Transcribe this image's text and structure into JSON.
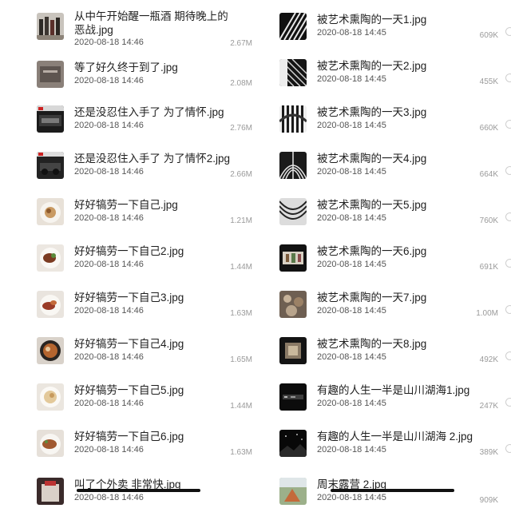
{
  "left_files": [
    {
      "name": "从中午开始醒一瓶酒 期待晚上的恶战.jpg",
      "date": "2020-08-18 14:46",
      "size": "2.67M",
      "thumbnail": "wine-bottles"
    },
    {
      "name": "等了好久终于到了.jpg",
      "date": "2020-08-18 14:46",
      "size": "2.08M",
      "thumbnail": "package-box"
    },
    {
      "name": "还是没忍住入手了 为了情怀.jpg",
      "date": "2020-08-18 14:46",
      "size": "2.76M",
      "thumbnail": "lego-box"
    },
    {
      "name": "还是没忍住入手了 为了情怀2.jpg",
      "date": "2020-08-18 14:46",
      "size": "2.66M",
      "thumbnail": "lego-car"
    },
    {
      "name": "好好犒劳一下自己.jpg",
      "date": "2020-08-18 14:46",
      "size": "1.21M",
      "thumbnail": "food-plate"
    },
    {
      "name": "好好犒劳一下自己2.jpg",
      "date": "2020-08-18 14:46",
      "size": "1.44M",
      "thumbnail": "food-plate"
    },
    {
      "name": "好好犒劳一下自己3.jpg",
      "date": "2020-08-18 14:46",
      "size": "1.63M",
      "thumbnail": "food-plate"
    },
    {
      "name": "好好犒劳一下自己4.jpg",
      "date": "2020-08-18 14:46",
      "size": "1.65M",
      "thumbnail": "food-bowl"
    },
    {
      "name": "好好犒劳一下自己5.jpg",
      "date": "2020-08-18 14:46",
      "size": "1.44M",
      "thumbnail": "food-plate"
    },
    {
      "name": "好好犒劳一下自己6.jpg",
      "date": "2020-08-18 14:46",
      "size": "1.63M",
      "thumbnail": "food-plate"
    },
    {
      "name": "叫了个外卖 非常快.jpg",
      "date": "2020-08-18 14:46",
      "size": "",
      "thumbnail": "takeout"
    }
  ],
  "right_files": [
    {
      "name": "被艺术熏陶的一天1.jpg",
      "date": "2020-08-18 14:45",
      "size": "609K",
      "thumbnail": "architecture"
    },
    {
      "name": "被艺术熏陶的一天2.jpg",
      "date": "2020-08-18 14:45",
      "size": "455K",
      "thumbnail": "architecture"
    },
    {
      "name": "被艺术熏陶的一天3.jpg",
      "date": "2020-08-18 14:45",
      "size": "660K",
      "thumbnail": "architecture"
    },
    {
      "name": "被艺术熏陶的一天4.jpg",
      "date": "2020-08-18 14:45",
      "size": "664K",
      "thumbnail": "architecture"
    },
    {
      "name": "被艺术熏陶的一天5.jpg",
      "date": "2020-08-18 14:45",
      "size": "760K",
      "thumbnail": "architecture"
    },
    {
      "name": "被艺术熏陶的一天6.jpg",
      "date": "2020-08-18 14:45",
      "size": "691K",
      "thumbnail": "gallery"
    },
    {
      "name": "被艺术熏陶的一天7.jpg",
      "date": "2020-08-18 14:45",
      "size": "1.00M",
      "thumbnail": "gallery"
    },
    {
      "name": "被艺术熏陶的一天8.jpg",
      "date": "2020-08-18 14:45",
      "size": "492K",
      "thumbnail": "gallery"
    },
    {
      "name": "有趣的人生一半是山川湖海1.jpg",
      "date": "2020-08-18 14:45",
      "size": "247K",
      "thumbnail": "night-scene"
    },
    {
      "name": "有趣的人生一半是山川湖海 2.jpg",
      "date": "2020-08-18 14:45",
      "size": "389K",
      "thumbnail": "night-scene"
    },
    {
      "name": "周末露营 2.jpg",
      "date": "2020-08-18 14:45",
      "size": "909K",
      "thumbnail": "camping"
    }
  ],
  "colors": {
    "text": "#1e1e1e",
    "date": "#555555",
    "size": "#9a9a9a",
    "background": "#ffffff"
  }
}
